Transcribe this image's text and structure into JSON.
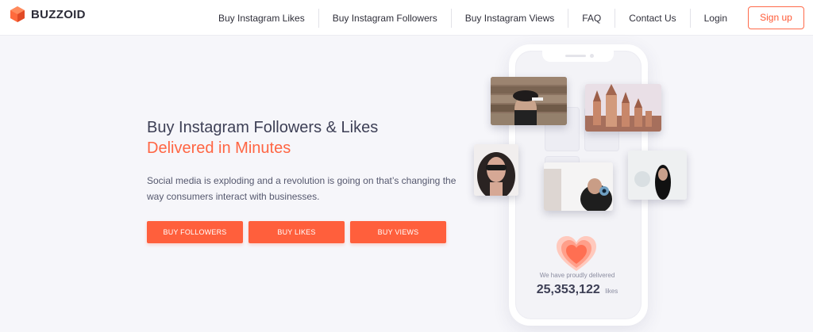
{
  "brand": {
    "name": "BUZZOID",
    "logo_color": "#ff5a36"
  },
  "nav": {
    "items": [
      {
        "label": "Buy Instagram Likes"
      },
      {
        "label": "Buy Instagram Followers"
      },
      {
        "label": "Buy Instagram Views"
      },
      {
        "label": "FAQ"
      },
      {
        "label": "Contact Us"
      },
      {
        "label": "Login"
      }
    ],
    "signup_label": "Sign up"
  },
  "hero": {
    "title": "Buy Instagram Followers & Likes",
    "title_accent": "Delivered in Minutes",
    "description": "Social media is exploding and a revolution is going on that’s changing the way consumers interact with businesses.",
    "buttons": [
      {
        "label": "BUY FOLLOWERS"
      },
      {
        "label": "BUY LIKES"
      },
      {
        "label": "BUY VIEWS"
      }
    ]
  },
  "stats": {
    "label": "We have proudly delivered",
    "count": "25,353,122",
    "unit": "likes"
  },
  "photos": [
    {
      "icon": "woman-hat-photo"
    },
    {
      "icon": "castle-photo"
    },
    {
      "icon": "woman-glasses-photo"
    },
    {
      "icon": "woman-eye-photo"
    },
    {
      "icon": "woman-dark-hair-photo"
    }
  ],
  "colors": {
    "accent": "#ff5f3c",
    "text": "#3d3f55",
    "background": "#f6f6fa"
  }
}
